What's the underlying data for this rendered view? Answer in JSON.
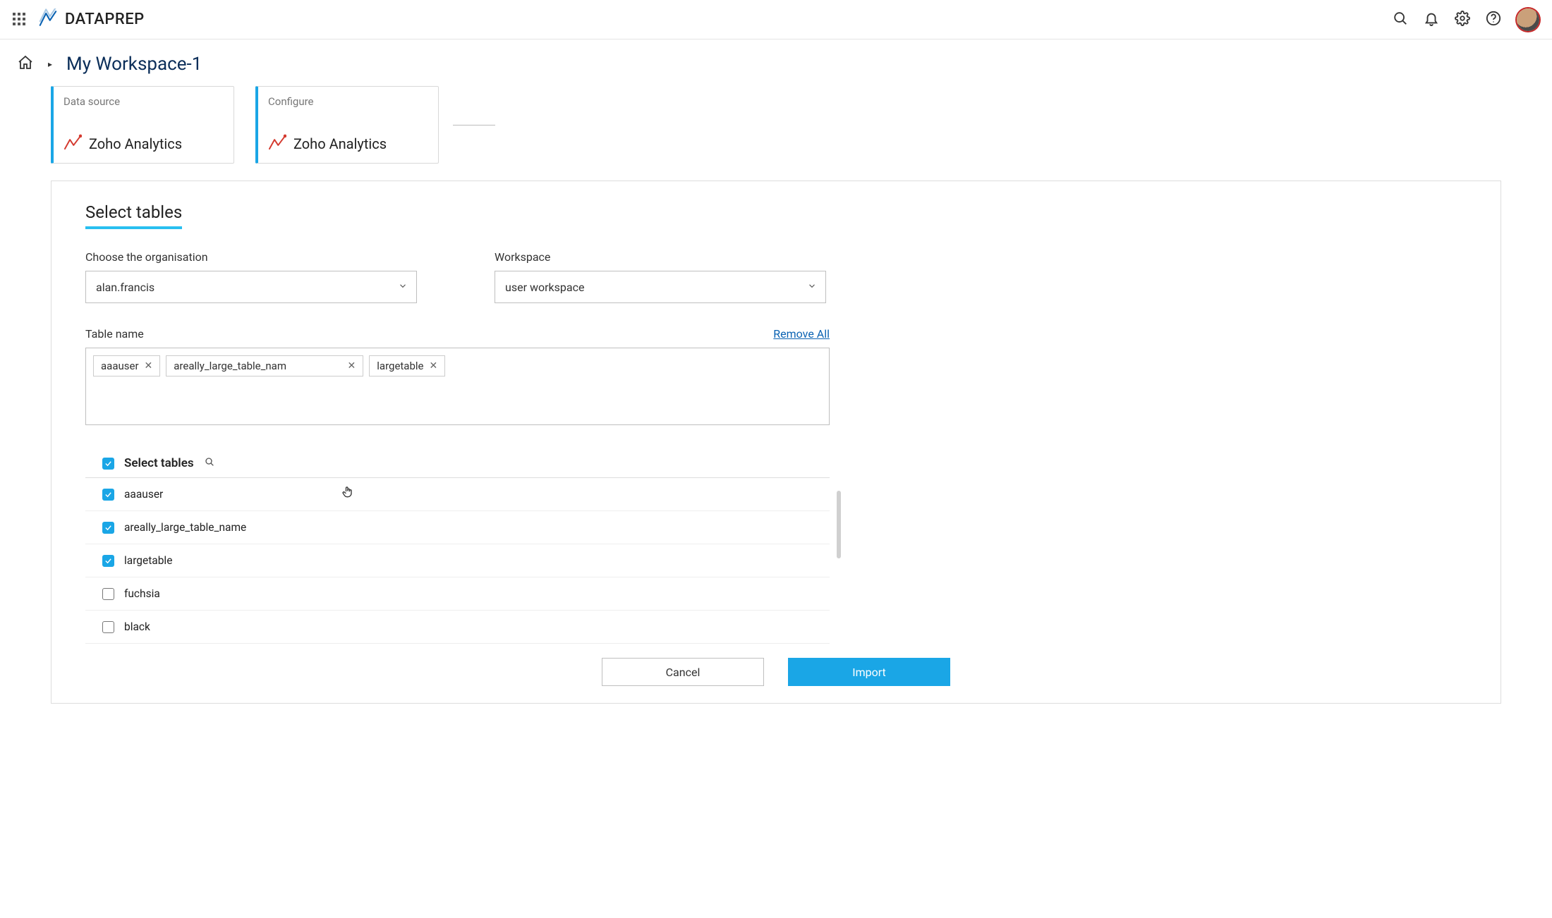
{
  "app": {
    "name": "DATAPREP"
  },
  "breadcrumb": {
    "title": "My Workspace-1"
  },
  "steps": [
    {
      "label": "Data source",
      "value": "Zoho Analytics"
    },
    {
      "label": "Configure",
      "value": "Zoho Analytics"
    }
  ],
  "panel": {
    "section_title": "Select tables",
    "org_label": "Choose the organisation",
    "org_value": "alan.francis",
    "workspace_label": "Workspace",
    "workspace_value": "user workspace",
    "table_name_label": "Table name",
    "remove_all": "Remove All",
    "tags": [
      {
        "label": "aaauser"
      },
      {
        "label": "areally_large_table_nam"
      },
      {
        "label": "largetable"
      }
    ],
    "list_title": "Select tables",
    "tables": [
      {
        "label": "aaauser",
        "checked": true
      },
      {
        "label": "areally_large_table_name",
        "checked": true
      },
      {
        "label": "largetable",
        "checked": true
      },
      {
        "label": "fuchsia",
        "checked": false
      },
      {
        "label": "black",
        "checked": false
      }
    ],
    "cancel": "Cancel",
    "import": "Import"
  }
}
